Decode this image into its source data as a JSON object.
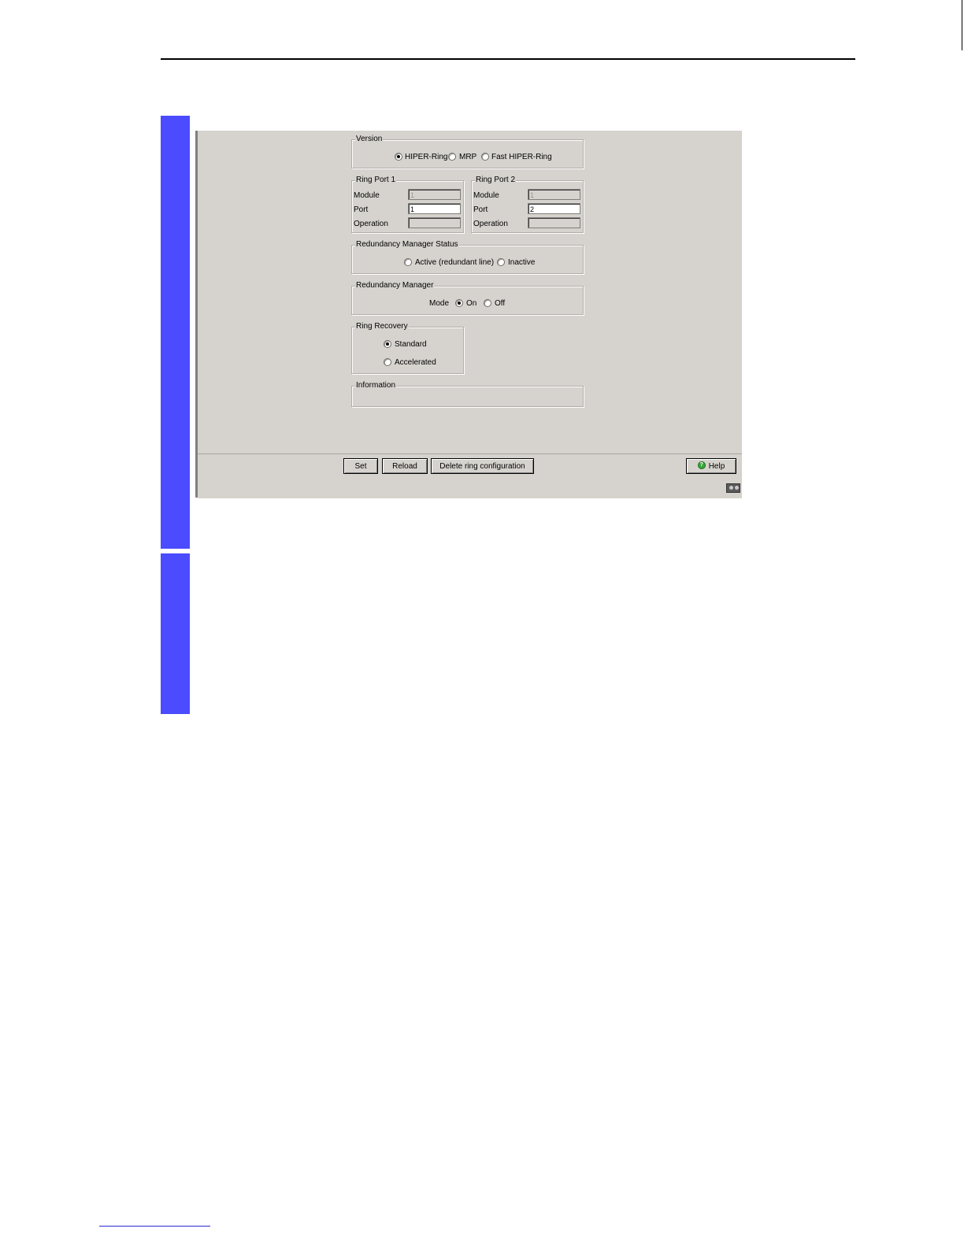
{
  "version": {
    "legend": "Version",
    "options": [
      {
        "label": "HIPER-Ring",
        "checked": true
      },
      {
        "label": "MRP",
        "checked": false
      },
      {
        "label": "Fast HIPER-Ring",
        "checked": false
      }
    ]
  },
  "ring_port_1": {
    "legend": "Ring Port 1",
    "module_label": "Module",
    "module_value": "1",
    "port_label": "Port",
    "port_value": "1",
    "operation_label": "Operation",
    "operation_value": ""
  },
  "ring_port_2": {
    "legend": "Ring Port 2",
    "module_label": "Module",
    "module_value": "1",
    "port_label": "Port",
    "port_value": "2",
    "operation_label": "Operation",
    "operation_value": ""
  },
  "rm_status": {
    "legend": "Redundancy Manager Status",
    "options": [
      {
        "label": "Active (redundant line)",
        "checked": false
      },
      {
        "label": "Inactive",
        "checked": false
      }
    ]
  },
  "rm": {
    "legend": "Redundancy Manager",
    "mode_label": "Mode",
    "options": [
      {
        "label": "On",
        "checked": true
      },
      {
        "label": "Off",
        "checked": false
      }
    ]
  },
  "ring_recovery": {
    "legend": "Ring Recovery",
    "options": [
      {
        "label": "Standard",
        "checked": true
      },
      {
        "label": "Accelerated",
        "checked": false
      }
    ]
  },
  "information": {
    "legend": "Information"
  },
  "buttons": {
    "set": "Set",
    "reload": "Reload",
    "delete": "Delete ring configuration",
    "help": "Help"
  },
  "icons": {
    "help": "help-icon",
    "status": "applet-status-icon"
  },
  "colors": {
    "side_bar": "#4b4bff",
    "window_bg": "#d6d3ce"
  }
}
